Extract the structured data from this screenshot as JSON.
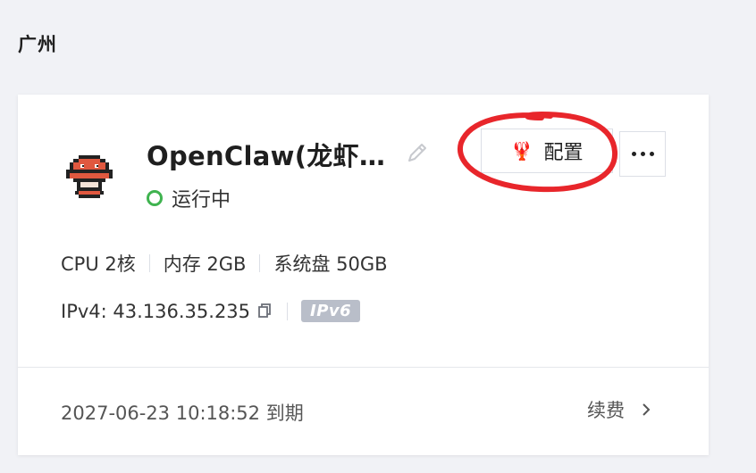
{
  "region": {
    "title": "广州"
  },
  "instance": {
    "name": "OpenClaw(龙虾…",
    "status": "运行中",
    "status_color": "#3fb34f",
    "avatar_icon": "lobster-pixel-icon"
  },
  "actions": {
    "config_label": "配置",
    "config_icon": "lobster-icon",
    "more_icon": "more-dots-icon",
    "edit_icon": "pencil-icon"
  },
  "specs": {
    "cpu": "CPU 2核",
    "memory": "内存 2GB",
    "disk": "系统盘 50GB"
  },
  "network": {
    "ipv4": "IPv4: 43.136.35.235",
    "ipv6_badge": "IPv6",
    "copy_icon": "copy-icon"
  },
  "footer": {
    "expire": "2027-06-23 10:18:52 到期",
    "renew_label": "续费"
  },
  "annotation": {
    "color": "#e8262b"
  }
}
